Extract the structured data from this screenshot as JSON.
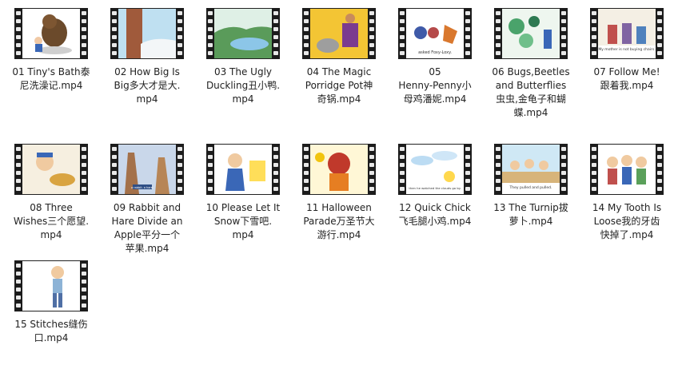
{
  "files": [
    {
      "name": "01 Tiny's Bath泰尼洗澡记.mp4",
      "line1": "01 Tiny's Bath泰",
      "line2": "尼洗澡记.mp4",
      "line3": "",
      "thumb": "bear-boy-icon"
    },
    {
      "name": "02 How Big Is Big多大才是大.mp4",
      "line1": "02 How Big Is",
      "line2": "Big多大才是大.",
      "line3": "mp4",
      "thumb": "tree-sky-icon"
    },
    {
      "name": "03 The Ugly Duckling丑小鸭.mp4",
      "line1": "03 The Ugly",
      "line2": "Duckling丑小鸭.",
      "line3": "mp4",
      "thumb": "pond-landscape-icon"
    },
    {
      "name": "04 The Magic Porridge Pot神奇锅.mp4",
      "line1": "04 The Magic",
      "line2": "Porridge Pot神",
      "line3": "奇锅.mp4",
      "thumb": "cooking-woman-icon"
    },
    {
      "name": "05 Henny-Penny小母鸡潘妮.mp4",
      "line1": "05",
      "line2": "Henny-Penny小",
      "line3": "母鸡潘妮.mp4",
      "thumb": "hen-fox-icon",
      "caption": "asked Foxy-Loxy."
    },
    {
      "name": "06 Bugs,Beetles and Butterflies虫虫,金龟子和蝴蝶.mp4",
      "line1": "06 Bugs,Beetles",
      "line2": "and Butterflies",
      "line3": "虫虫,金龟子和蝴",
      "line4": "蝶.mp4",
      "thumb": "bugs-leaves-icon"
    },
    {
      "name": "07 Follow Me!跟着我.mp4",
      "line1": "07 Follow Me!",
      "line2": "跟着我.mp4",
      "line3": "",
      "thumb": "family-room-icon",
      "caption": "My mother is not buying chairs."
    },
    {
      "name": "08 Three Wishes三个愿望.mp4",
      "line1": "08 Three",
      "line2": "Wishes三个愿望.",
      "line3": "mp4",
      "thumb": "old-man-icon"
    },
    {
      "name": "09 Rabbit and Hare Divide an Apple平分一个苹果.mp4",
      "line1": "09 Rabbit and",
      "line2": "Hare Divide an",
      "line3": "Apple平分一个",
      "line4": "苹果.mp4",
      "thumb": "rabbit-hare-icon",
      "caption": "a rabbit. a hare."
    },
    {
      "name": "10 Please Let It Snow下雪吧.mp4",
      "line1": "10 Please Let It",
      "line2": "Snow下雪吧.",
      "line3": "mp4",
      "thumb": "girl-window-icon"
    },
    {
      "name": "11 Halloween Parade万圣节大游行.mp4",
      "line1": "11 Halloween",
      "line2": "Parade万圣节大",
      "line3": "游行.mp4",
      "thumb": "costume-kids-icon"
    },
    {
      "name": "12 Quick Chick飞毛腿小鸡.mp4",
      "line1": "12 Quick Chick",
      "line2": "飞毛腿小鸡.mp4",
      "line3": "",
      "thumb": "chick-clouds-icon",
      "caption": "then he watched the clouds go by."
    },
    {
      "name": "13 The Turnip拔萝卜.mp4",
      "line1": "13 The Turnip拔",
      "line2": "萝卜.mp4",
      "line3": "",
      "thumb": "turnip-pull-icon",
      "caption": "They pulled and pulled."
    },
    {
      "name": "14 My Tooth Is Loose我的牙齿快掉了.mp4",
      "line1": "14 My Tooth Is",
      "line2": "Loose我的牙齿",
      "line3": "快掉了.mp4",
      "thumb": "kids-group-icon"
    },
    {
      "name": "15 Stitches缝伤口.mp4",
      "line1": "15 Stitches缝伤",
      "line2": "口.mp4",
      "line3": "",
      "thumb": "boy-standing-icon"
    }
  ]
}
